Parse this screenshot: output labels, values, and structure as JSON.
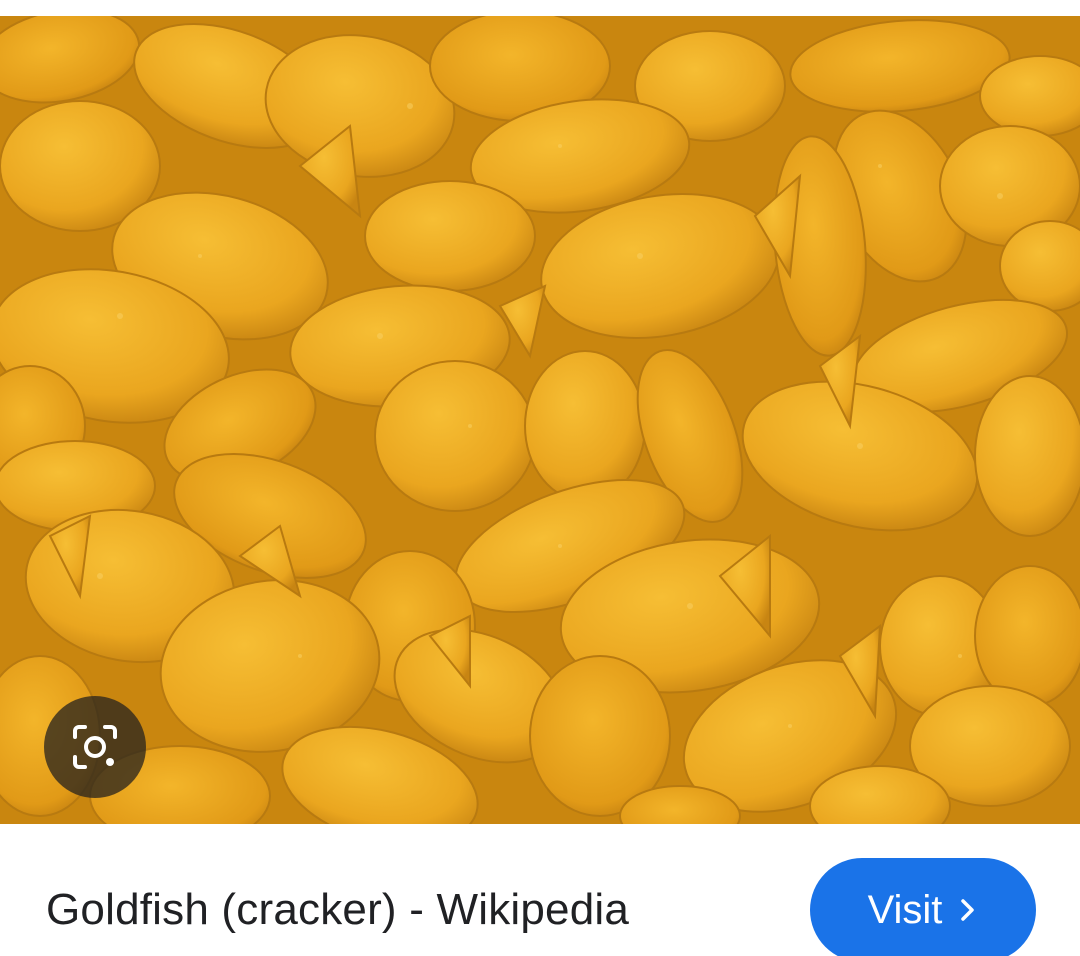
{
  "image": {
    "subject": "goldfish-crackers-photo",
    "dominant_color": "#e2a21b"
  },
  "lens": {
    "icon": "camera-lens-icon"
  },
  "result": {
    "title": "Goldfish (cracker) - Wikipedia"
  },
  "visit": {
    "label": "Visit",
    "icon": "chevron-right-icon",
    "color": "#1a73e8"
  }
}
